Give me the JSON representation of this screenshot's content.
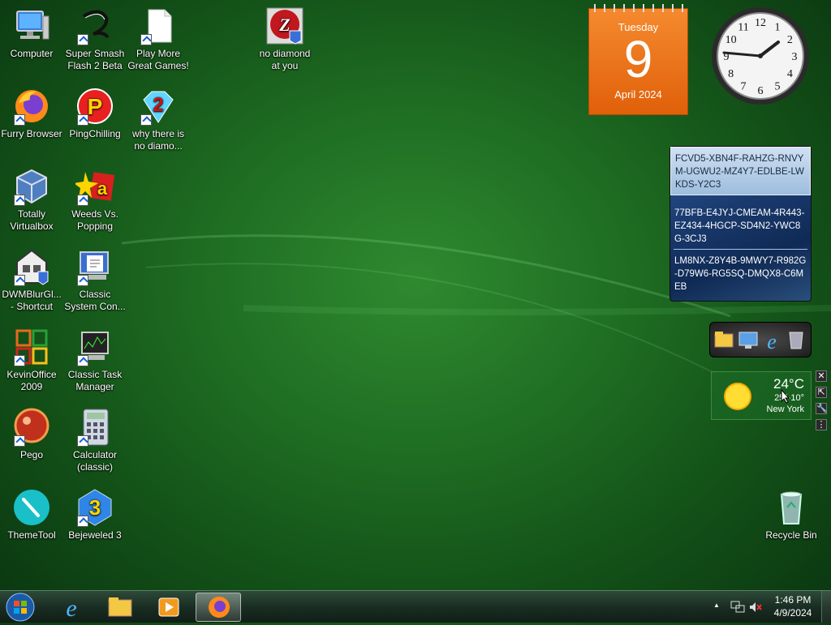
{
  "desktop": {
    "icons": [
      {
        "label": "Computer"
      },
      {
        "label": "Super Smash Flash 2 Beta"
      },
      {
        "label": "Play More Great Games!"
      },
      {
        "label": "no diamond at you"
      },
      {
        "label": "Furry Browser"
      },
      {
        "label": "PingChilling"
      },
      {
        "label": "why there is no diamo..."
      },
      {
        "label": "Totally Virtualbox"
      },
      {
        "label": "Weeds Vs. Popping"
      },
      {
        "label": "DWMBlurGl... - Shortcut"
      },
      {
        "label": "Classic System Con..."
      },
      {
        "label": "KevinOffice 2009"
      },
      {
        "label": "Classic Task Manager"
      },
      {
        "label": "Pego"
      },
      {
        "label": "Calculator (classic)"
      },
      {
        "label": "ThemeTool"
      },
      {
        "label": "Bejeweled 3"
      },
      {
        "label": "Recycle Bin"
      }
    ]
  },
  "calendar_gadget": {
    "weekday": "Tuesday",
    "day": "9",
    "month_year": "April 2024"
  },
  "clock_gadget": {
    "numbers": [
      "12",
      "1",
      "2",
      "3",
      "4",
      "5",
      "6",
      "7",
      "8",
      "9",
      "10",
      "11"
    ],
    "time": "1:46"
  },
  "keys_gadget": {
    "keys": [
      "FCVD5-XBN4F-RAHZG-RNVYM-UGWU2-MZ4Y7-EDLBE-LWKDS-Y2C3",
      "77BFB-E4JYJ-CMEAM-4R443-EZ434-4HGCP-SD4N2-YWC8G-3CJ3",
      "LM8NX-Z8Y4B-9MWY7-R982G-D79W6-RG5SQ-DMQX8-C6MEB"
    ]
  },
  "weather_gadget": {
    "temp": "24°C",
    "range": "25°-10°",
    "city": "New York"
  },
  "gadget_tools": {
    "close": "✕",
    "size": "⇱",
    "options": "🔧",
    "drag": "⋮"
  },
  "taskbar": {
    "time": "1:46 PM",
    "date": "4/9/2024",
    "tray_arrow": "▲"
  },
  "colors": {
    "calendar_orange": "#ee7518",
    "desktop_green": "#1f6e23",
    "taskbar": "#1a2e23"
  }
}
